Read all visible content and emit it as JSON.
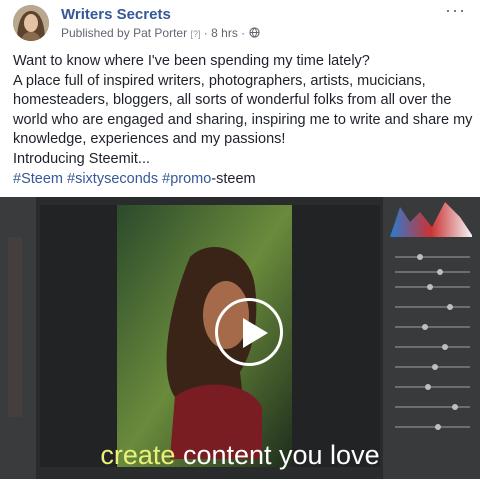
{
  "post": {
    "page_name": "Writers Secrets",
    "published_prefix": "Published by",
    "author": "Pat Porter",
    "help": "[?]",
    "separator": "·",
    "time": "8 hrs",
    "more": "···",
    "lines": [
      "Want to know where I've been spending my time lately?",
      "A place full of inspired writers, photographers, artists, mucicians, homesteaders, bloggers, all sorts of wonderful folks from all over the world who are engaged and sharing, inspiring me to write and share my knowledge, experiences and my passions!",
      "Introducing Steemit..."
    ],
    "hashtags": [
      "#Steem",
      "#sixtyseconds",
      "#promo"
    ],
    "hashtag_suffix": "-steem"
  },
  "video": {
    "caption_highlight": "create",
    "caption_rest": "content you love"
  },
  "icons": {
    "more": "more-icon",
    "play": "play-icon",
    "globe": "globe-icon"
  }
}
